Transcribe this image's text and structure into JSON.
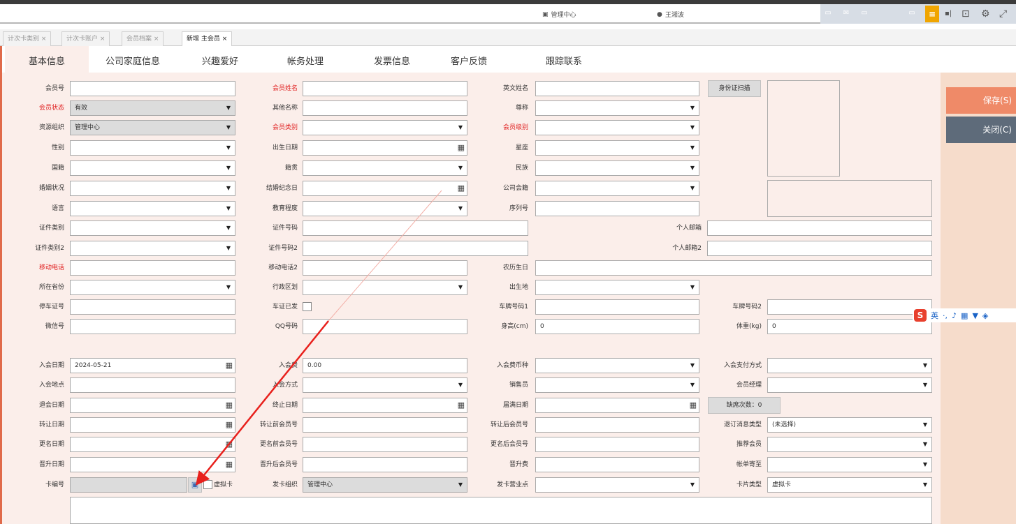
{
  "topbar": {
    "org": "管理中心",
    "user": "王湘波"
  },
  "doc_tabs": [
    {
      "label": "计次卡类别 ×"
    },
    {
      "label": "计次卡账户 ×"
    },
    {
      "label": "会员档案 ×"
    },
    {
      "label": "新增 主会员 ×"
    }
  ],
  "category_tabs": [
    {
      "label": "基本信息"
    },
    {
      "label": "公司家庭信息"
    },
    {
      "label": "兴趣爱好"
    },
    {
      "label": "帐务处理"
    },
    {
      "label": "发票信息"
    },
    {
      "label": "客户反馈"
    },
    {
      "label": "跟踪联系"
    }
  ],
  "actions": {
    "save": "保存(S)",
    "close": "关闭(C)",
    "id_scan": "身份证扫描",
    "absence": "缺席次数：0"
  },
  "labels": {
    "member_no": "会员号",
    "member_name": "会员姓名",
    "english_name": "英文姓名",
    "member_status": "会员状态",
    "other_name": "其他名称",
    "title": "尊称",
    "resource_org": "资源组织",
    "member_type": "会员类别",
    "member_level": "会员级别",
    "gender": "性别",
    "birth_date": "出生日期",
    "constellation": "星座",
    "nationality": "国籍",
    "native_place": "籍贯",
    "ethnicity": "民族",
    "marital": "婚姻状况",
    "wedding_date": "结婚纪念日",
    "company_membership": "公司会籍",
    "language": "语言",
    "education": "教育程度",
    "serial_no": "序列号",
    "id_type": "证件类别",
    "id_no": "证件号码",
    "email": "个人邮箱",
    "id_type2": "证件类别2",
    "id_no2": "证件号码2",
    "email2": "个人邮箱2",
    "mobile": "移动电话",
    "mobile2": "移动电话2",
    "lunar_birthday": "农历生日",
    "province": "所在省份",
    "district": "行政区划",
    "birthplace": "出生地",
    "parking_no": "停车证号",
    "parking_issued": "车证已发",
    "plate1": "车牌号码1",
    "plate2": "车牌号码2",
    "wechat": "微信号",
    "qq": "QQ号码",
    "height": "身高(cm)",
    "weight": "体重(kg)",
    "join_date": "入会日期",
    "join_fee": "入会费",
    "join_fee_currency": "入会费币种",
    "join_pay_method": "入会支付方式",
    "join_place": "入会地点",
    "join_method": "入会方式",
    "salesperson": "销售员",
    "member_manager": "会员经理",
    "leave_date": "退会日期",
    "end_date": "终止日期",
    "expire_date": "届满日期",
    "transfer_date": "转让日期",
    "pre_transfer_no": "转让前会员号",
    "post_transfer_no": "转让后会员号",
    "unsub_msg_type": "退订消息类型",
    "rename_date": "更名日期",
    "pre_rename_no": "更名前会员号",
    "post_rename_no": "更名后会员号",
    "referrer": "推荐会员",
    "promote_date": "晋升日期",
    "pre_promote_no": "晋升后会员号",
    "promote_fee": "晋升费",
    "bill_mail_to": "帐单寄至",
    "card_no": "卡编号",
    "virtual_card": "虚拟卡",
    "issue_org": "发卡组织",
    "issue_point": "发卡营业点",
    "card_type": "卡片类型"
  },
  "values": {
    "member_status": "有效",
    "resource_org": "管理中心",
    "height": "0",
    "weight": "0",
    "join_date": "2024-05-21",
    "join_fee": "0.00",
    "unsub_msg_type": "(未选择)",
    "issue_org": "管理中心",
    "card_type": "虚拟卡"
  },
  "ime": {
    "logo": "S",
    "mode": "英"
  },
  "colors": {
    "accent_orange": "#ef8a68",
    "dark_slate": "#5e6b7a",
    "required_red": "#e02020",
    "form_bg": "#fbeeea",
    "annotation_arrow": "#e8201c"
  }
}
